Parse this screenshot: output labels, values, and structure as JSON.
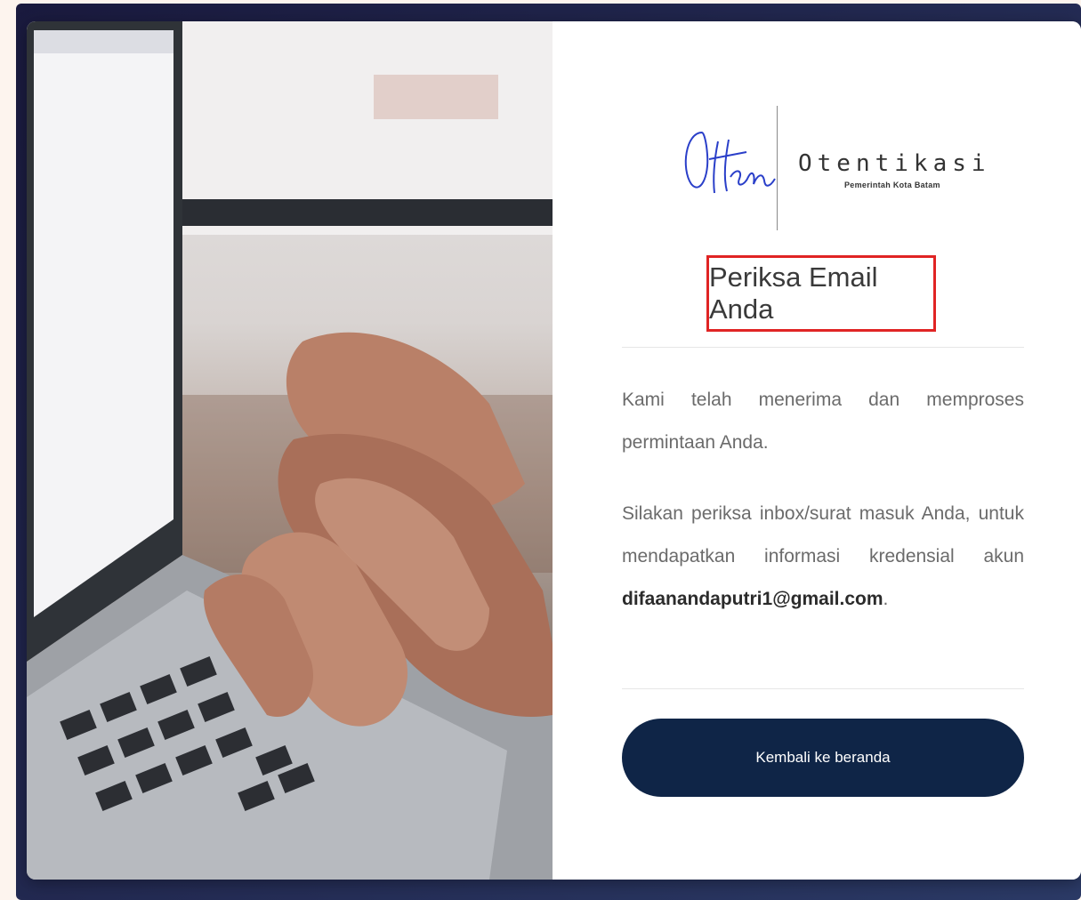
{
  "brand": {
    "script_logo_text": "Oten",
    "name": "Otentikasi",
    "subtitle": "Pemerintah Kota Batam"
  },
  "heading": "Periksa Email Anda",
  "message": {
    "paragraph1": "Kami telah menerima dan memproses permintaan Anda.",
    "paragraph2_prefix": "Silakan periksa inbox/surat masuk Anda, untuk mendapatkan informasi kredensial akun ",
    "email": "difaanandaputri1@gmail.com",
    "paragraph2_suffix": "."
  },
  "actions": {
    "home_button_label": "Kembali ke beranda"
  },
  "colors": {
    "button_bg": "#0f2547",
    "highlight_border": "#e02424",
    "logo_blue": "#2a3fc9"
  }
}
